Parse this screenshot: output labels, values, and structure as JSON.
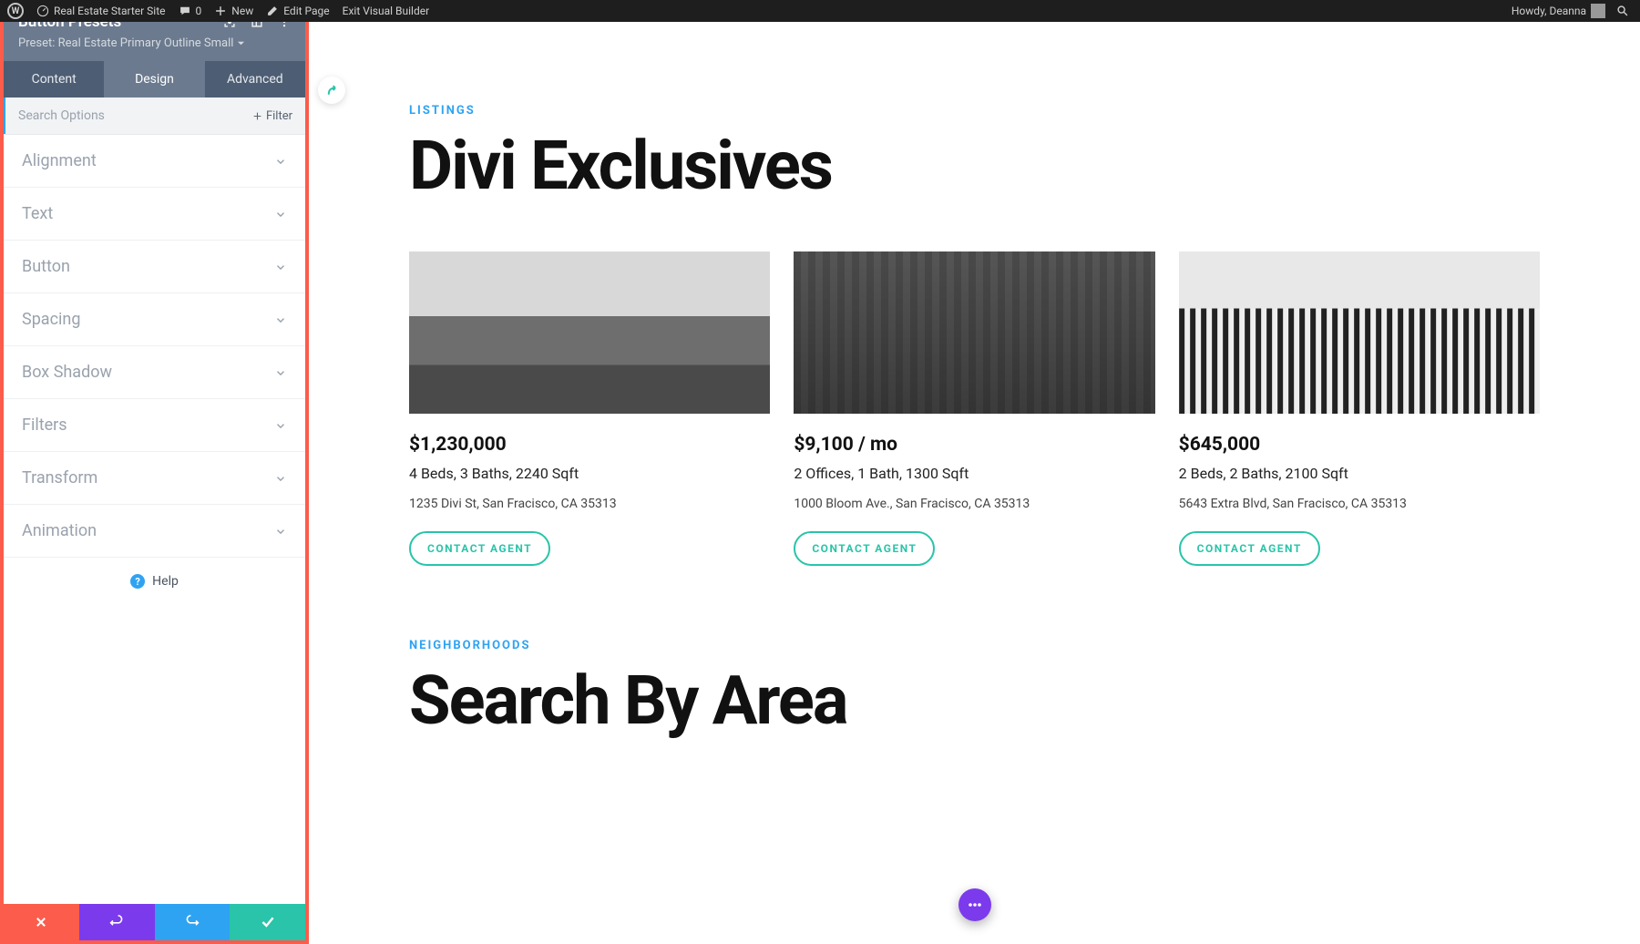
{
  "adminBar": {
    "siteName": "Real Estate Starter Site",
    "commentCount": "0",
    "newLabel": "New",
    "editPage": "Edit Page",
    "exitBuilder": "Exit Visual Builder",
    "greeting": "Howdy, Deanna"
  },
  "panel": {
    "title": "Button Presets",
    "presetLabel": "Preset: Real Estate Primary Outline Small",
    "tabs": {
      "content": "Content",
      "design": "Design",
      "advanced": "Advanced"
    },
    "searchPlaceholder": "Search Options",
    "filterLabel": "Filter",
    "sections": [
      {
        "label": "Alignment"
      },
      {
        "label": "Text"
      },
      {
        "label": "Button"
      },
      {
        "label": "Spacing"
      },
      {
        "label": "Box Shadow"
      },
      {
        "label": "Filters"
      },
      {
        "label": "Transform"
      },
      {
        "label": "Animation"
      }
    ],
    "help": "Help"
  },
  "page": {
    "listingsEyebrow": "LISTINGS",
    "listingsTitle": "Divi Exclusives",
    "cards": [
      {
        "price": "$1,230,000",
        "specs": "4 Beds, 3 Baths, 2240 Sqft",
        "address": "1235 Divi St, San Fracisco, CA 35313",
        "cta": "CONTACT AGENT"
      },
      {
        "price": "$9,100 / mo",
        "specs": "2 Offices, 1 Bath, 1300 Sqft",
        "address": "1000 Bloom Ave., San Fracisco, CA 35313",
        "cta": "CONTACT AGENT"
      },
      {
        "price": "$645,000",
        "specs": "2 Beds, 2 Baths, 2100 Sqft",
        "address": "5643 Extra Blvd, San Fracisco, CA 35313",
        "cta": "CONTACT AGENT"
      }
    ],
    "neighborhoodsEyebrow": "NEIGHBORHOODS",
    "neighborhoodsTitle": "Search By Area"
  }
}
